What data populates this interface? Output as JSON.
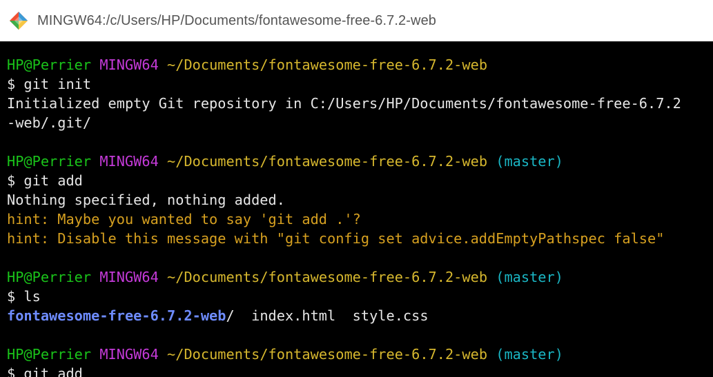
{
  "window": {
    "title": "MINGW64:/c/Users/HP/Documents/fontawesome-free-6.7.2-web",
    "icon": "git-bash-diamond-icon"
  },
  "colors": {
    "prompt_user": "#1ac41a",
    "prompt_shell": "#c43ad8",
    "prompt_path": "#d6b72e",
    "prompt_branch": "#1ab6c4",
    "output": "#e6e6e6",
    "directory": "#6e8cff",
    "hint": "#d6a020"
  },
  "terminal": {
    "blocks": [
      {
        "prompt": {
          "user_host": "HP@Perrier",
          "shell": "MINGW64",
          "path": "~/Documents/fontawesome-free-6.7.2-web",
          "branch": ""
        },
        "command": "$ git init",
        "output": [
          "Initialized empty Git repository in C:/Users/HP/Documents/fontawesome-free-6.7.2",
          "-web/.git/"
        ]
      },
      {
        "prompt": {
          "user_host": "HP@Perrier",
          "shell": "MINGW64",
          "path": "~/Documents/fontawesome-free-6.7.2-web",
          "branch": "(master)"
        },
        "command": "$ git add",
        "output": [
          "Nothing specified, nothing added."
        ],
        "hints": [
          "hint: Maybe you wanted to say 'git add .'?",
          "hint: Disable this message with \"git config set advice.addEmptyPathspec false\""
        ]
      },
      {
        "prompt": {
          "user_host": "HP@Perrier",
          "shell": "MINGW64",
          "path": "~/Documents/fontawesome-free-6.7.2-web",
          "branch": "(master)"
        },
        "command": "$ ls",
        "ls_output": {
          "dir": "fontawesome-free-6.7.2-web",
          "dir_suffix": "/",
          "files": "  index.html  style.css"
        }
      },
      {
        "prompt": {
          "user_host": "HP@Perrier",
          "shell": "MINGW64",
          "path": "~/Documents/fontawesome-free-6.7.2-web",
          "branch": "(master)"
        },
        "command": "$ git add"
      }
    ]
  }
}
